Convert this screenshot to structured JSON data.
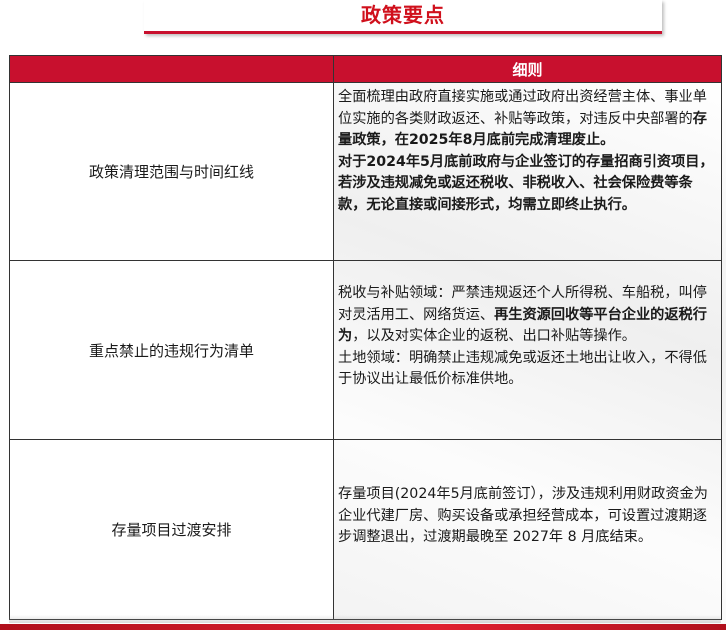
{
  "title": "政策要点",
  "table": {
    "header_col1": "",
    "header_col2": "细则",
    "rows": [
      {
        "label": "政策清理范围与时间红线",
        "detail": [
          {
            "text": "全面梳理由政府直接实施或通过政府出资经营主体、事业单位实施的各类财政返还、补贴等政策，对违反中央部署的",
            "bold": false
          },
          {
            "text": "存量政策，在2025年8月底前完成清理废止。",
            "bold": true
          },
          {
            "text": "对于2024年5月底前政府与企业签订的存量招商引资项目，若涉及违规减免或返还税收、非税收入、社会保险费等条款，无论直接或间接形式，均需立即终止执行。",
            "bold": true
          }
        ]
      },
      {
        "label": "重点禁止的违规行为清单",
        "detail": [
          {
            "text": "税收与补贴领域：严禁违规返还个人所得税、车船税，叫停对灵活用工、网络货运、",
            "bold": false
          },
          {
            "text": "再生资源回收等平台企业的返税行为",
            "bold": true
          },
          {
            "text": "，以及对实体企业的返税、出口补贴等操作。",
            "bold": false
          },
          {
            "text": "土地领域：明确禁止违规减免或返还土地出让收入，不得低于协议出让最低价标准供地。",
            "bold": false
          }
        ]
      },
      {
        "label": "存量项目过渡安排",
        "detail": [
          {
            "text": "存量项目(2024年5月底前签订），涉及违规利用财政资金为企业代建厂房、购买设备或承担经营成本，可设置过渡期逐步调整退出，过渡期最晚至 2027年 8 月底结束。",
            "bold": false
          }
        ]
      }
    ]
  },
  "colors": {
    "accent": "#c8102e",
    "title_text": "#d0101c",
    "border": "#333333"
  }
}
